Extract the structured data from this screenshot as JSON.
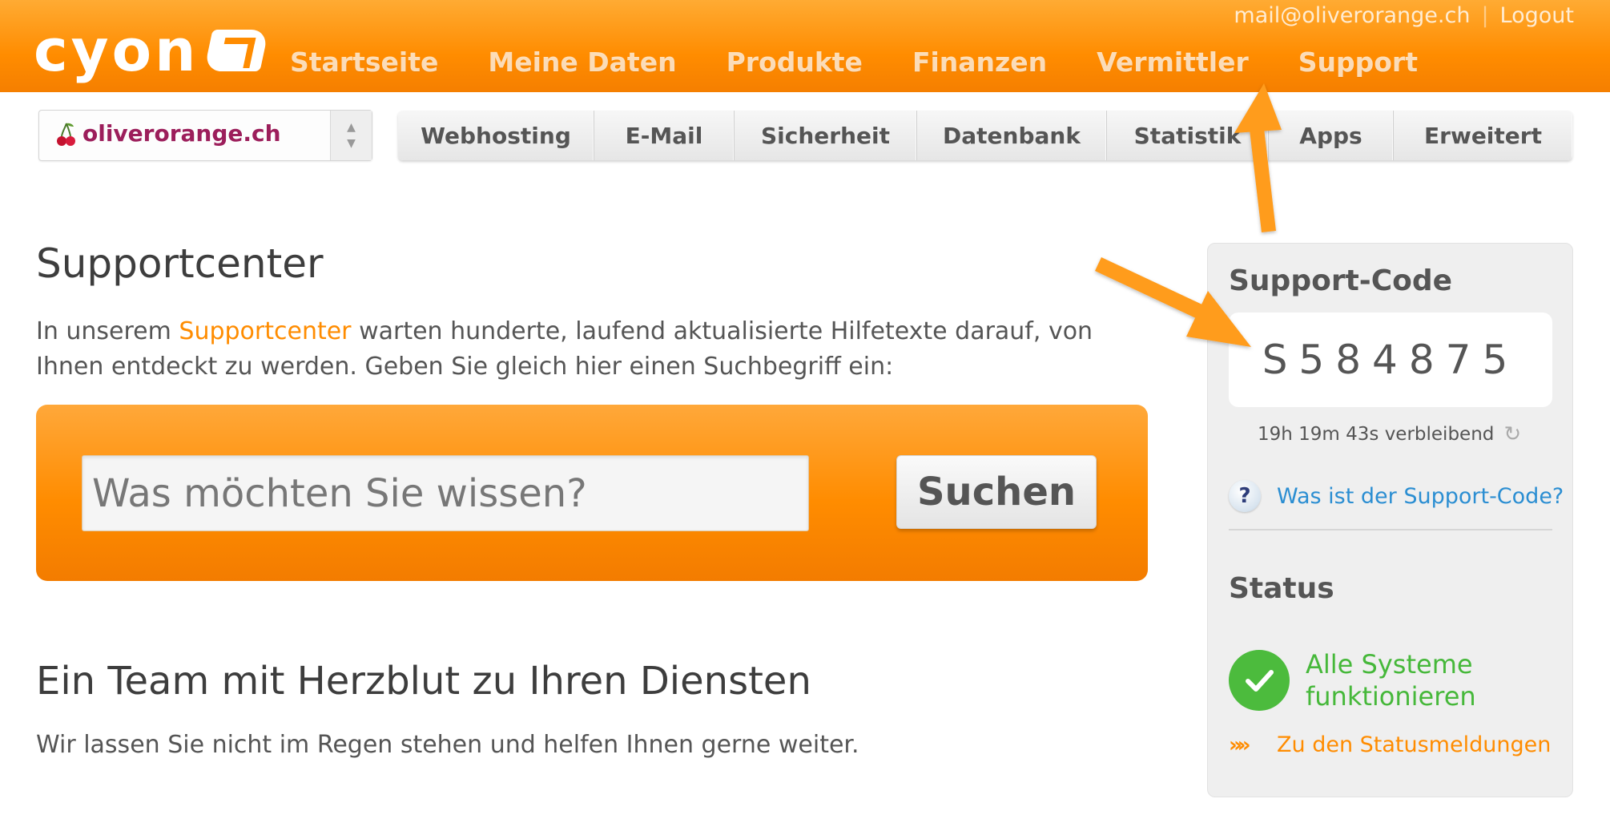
{
  "header": {
    "logo_text": "cyon",
    "nav": [
      "Startseite",
      "Meine Daten",
      "Produkte",
      "Finanzen",
      "Vermittler",
      "Support"
    ],
    "user_email": "mail@oliverorange.ch",
    "separator": "|",
    "logout_label": "Logout"
  },
  "domain_select": {
    "selected": "oliverorange.ch"
  },
  "subtabs": [
    {
      "label": "Webhosting",
      "width": 245
    },
    {
      "label": "E-Mail",
      "width": 175
    },
    {
      "label": "Sicherheit",
      "width": 228
    },
    {
      "label": "Datenbank",
      "width": 237
    },
    {
      "label": "Statistik",
      "width": 202
    },
    {
      "label": "Apps",
      "width": 156
    },
    {
      "label": "Erweitert",
      "width": 223
    }
  ],
  "main": {
    "title": "Supportcenter",
    "intro_before": "In unserem ",
    "intro_link": "Supportcenter",
    "intro_after": " warten hunderte, laufend aktualisierte Hilfetexte darauf, von Ihnen entdeckt zu werden. Geben Sie gleich hier einen Suchbegriff ein:",
    "search_placeholder": "Was möchten Sie wissen?",
    "search_button": "Suchen",
    "team_title": "Ein Team mit Herzblut zu Ihren Diensten",
    "team_text": "Wir lassen Sie nicht im Regen stehen und helfen Ihnen gerne weiter."
  },
  "sidebar": {
    "support_code_title": "Support-Code",
    "support_code": "S584875",
    "remaining": "19h 19m 43s verbleibend",
    "help_link": "Was ist der Support-Code?",
    "status_title": "Status",
    "status_text": "Alle Systeme funktionieren",
    "status_link": "Zu den Statusmeldungen"
  },
  "colors": {
    "brand_orange": "#ff8c00",
    "domain_text": "#9c1e5b",
    "link_blue": "#2b8ed2",
    "status_green": "#4cbb3d"
  },
  "icons": [
    "cyon-logo-icon",
    "cherry-icon",
    "select-arrows-icon",
    "refresh-icon",
    "question-icon",
    "checkmark-icon",
    "double-chevron-icon"
  ]
}
